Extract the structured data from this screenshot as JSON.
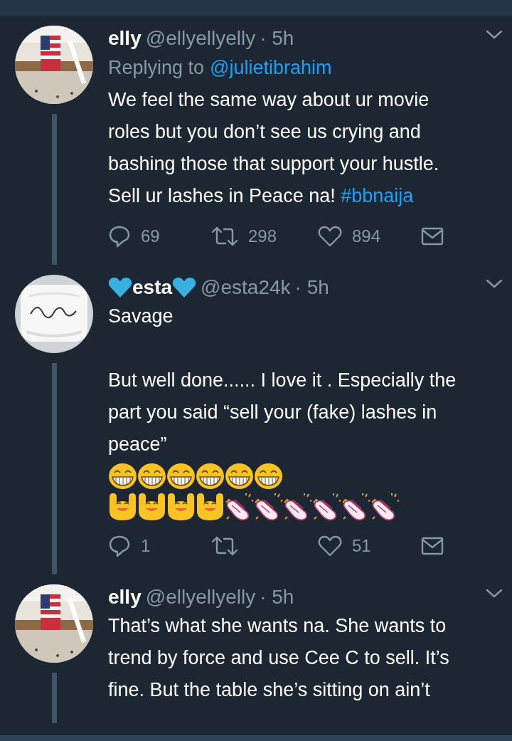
{
  "tweets": [
    {
      "name": "elly",
      "name_hearts": false,
      "handle": "@ellyellyelly",
      "time": "· 5h",
      "avatar": {
        "kind": "picture"
      },
      "replying_label": "Replying to",
      "replying_to": "@julietibrahim",
      "paragraphs": [
        [
          {
            "kind": "text",
            "text": "We feel the same way about ur movie roles but you don’t see us crying and bashing those that support your hustle. Sell ur lashes in Peace na! "
          },
          {
            "kind": "hashtag",
            "text": "#bbnaija"
          }
        ]
      ],
      "replies": "69",
      "retweets": "298",
      "likes": "894",
      "thread_below": true
    },
    {
      "name": "esta",
      "name_hearts": true,
      "handle": "@esta24k",
      "time": "· 5h",
      "avatar": {
        "kind": "picture"
      },
      "paragraphs": [
        [
          {
            "kind": "text",
            "text": "Savage\n\nBut well done...... I love it . Especially the part you said “sell your (fake) lashes in peace”"
          }
        ]
      ],
      "emoji_rows": [
        [
          {
            "kind": "grin"
          },
          {
            "kind": "grin"
          },
          {
            "kind": "grin"
          },
          {
            "kind": "grin"
          },
          {
            "kind": "grin"
          },
          {
            "kind": "grin"
          }
        ],
        [
          {
            "kind": "raise"
          },
          {
            "kind": "raise"
          },
          {
            "kind": "raise"
          },
          {
            "kind": "raise"
          },
          {
            "kind": "clap"
          },
          {
            "kind": "clap"
          },
          {
            "kind": "clap"
          },
          {
            "kind": "clap"
          },
          {
            "kind": "clap"
          },
          {
            "kind": "clap"
          }
        ]
      ],
      "replies": "1",
      "likes": "51",
      "thread_below": true
    },
    {
      "name": "elly",
      "name_hearts": false,
      "handle": "@ellyellyelly",
      "time": "· 5h",
      "avatar": {
        "kind": "picture"
      },
      "paragraphs": [
        [
          {
            "kind": "text",
            "text": "That’s what she wants na. She wants to trend by force and use Cee C to sell. It’s fine. But the table she’s sitting on ain’t"
          }
        ]
      ],
      "thread_below": true
    }
  ]
}
